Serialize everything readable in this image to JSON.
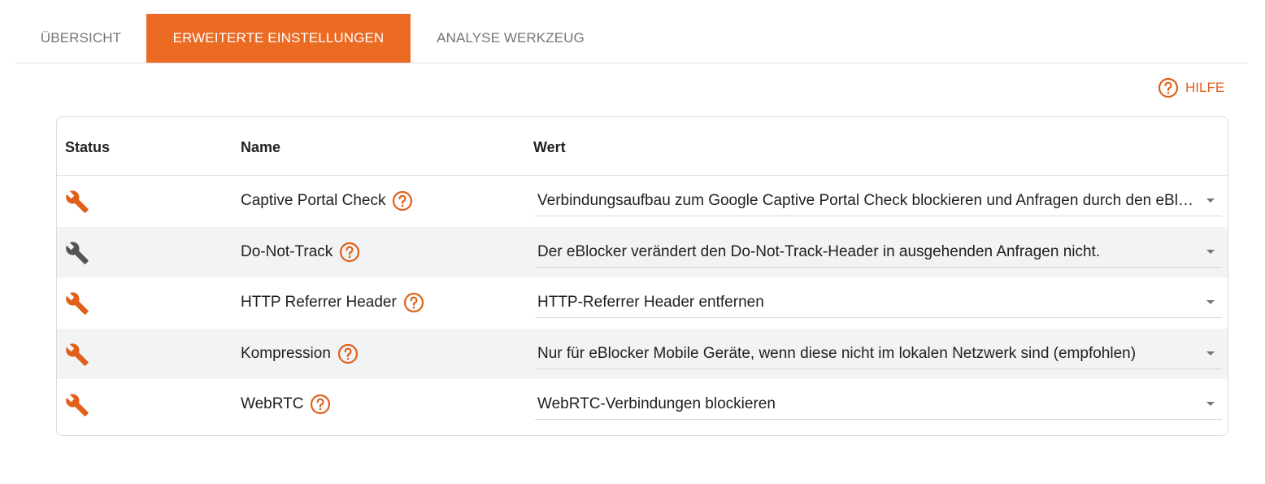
{
  "tabs": [
    {
      "label": "ÜBERSICHT",
      "active": false
    },
    {
      "label": "ERWEITERTE EINSTELLUNGEN",
      "active": true
    },
    {
      "label": "ANALYSE WERKZEUG",
      "active": false
    }
  ],
  "help": {
    "label": "HILFE",
    "icon": "help-circle-icon"
  },
  "colors": {
    "accent": "#ec6b23",
    "icon_active": "#e0601a",
    "icon_inactive": "#555555",
    "row_alt": "#f1f3f4"
  },
  "table": {
    "headers": {
      "status": "Status",
      "name": "Name",
      "value": "Wert"
    },
    "rows": [
      {
        "status": "active",
        "status_icon": "wrench-icon",
        "name": "Captive Portal Check",
        "value": "Verbindungsaufbau zum Google Captive Portal Check blockieren und Anfragen durch den eBlocker beantworten"
      },
      {
        "status": "inactive",
        "status_icon": "wrench-icon",
        "name": "Do-Not-Track",
        "value": "Der eBlocker verändert den Do-Not-Track-Header in ausgehenden Anfragen nicht."
      },
      {
        "status": "active",
        "status_icon": "wrench-icon",
        "name": "HTTP Referrer Header",
        "value": "HTTP-Referrer Header entfernen"
      },
      {
        "status": "active",
        "status_icon": "wrench-icon",
        "name": "Kompression",
        "value": "Nur für eBlocker Mobile Geräte, wenn diese nicht im lokalen Netzwerk sind (empfohlen)"
      },
      {
        "status": "active",
        "status_icon": "wrench-icon",
        "name": "WebRTC",
        "value": "WebRTC-Verbindungen blockieren"
      }
    ]
  }
}
